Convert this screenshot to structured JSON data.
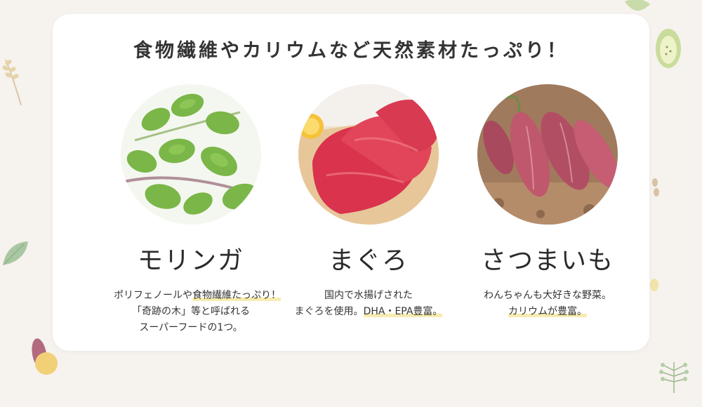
{
  "title": "食物繊維やカリウムなど天然素材たっぷり！",
  "items": [
    {
      "name": "モリンガ",
      "lines": [
        {
          "pre": "ポリフェノールや",
          "hl": "食物繊維たっぷり！",
          "post": ""
        },
        {
          "pre": "「奇跡の木」等と呼ばれる",
          "hl": "",
          "post": ""
        },
        {
          "pre": "スーパーフードの1つ。",
          "hl": "",
          "post": ""
        }
      ]
    },
    {
      "name": "まぐろ",
      "lines": [
        {
          "pre": "国内で水揚げされた",
          "hl": "",
          "post": ""
        },
        {
          "pre": "まぐろを使用。",
          "hl": "DHA・EPA豊富。",
          "post": ""
        }
      ]
    },
    {
      "name": "さつまいも",
      "lines": [
        {
          "pre": "わんちゃんも大好きな野菜。",
          "hl": "",
          "post": ""
        },
        {
          "pre": "",
          "hl": "カリウムが豊富。",
          "post": ""
        }
      ]
    }
  ],
  "icons": {
    "moringa": "moringa-leaves-photo",
    "tuna": "tuna-sashimi-photo",
    "sweet_potato": "sweet-potato-photo"
  }
}
